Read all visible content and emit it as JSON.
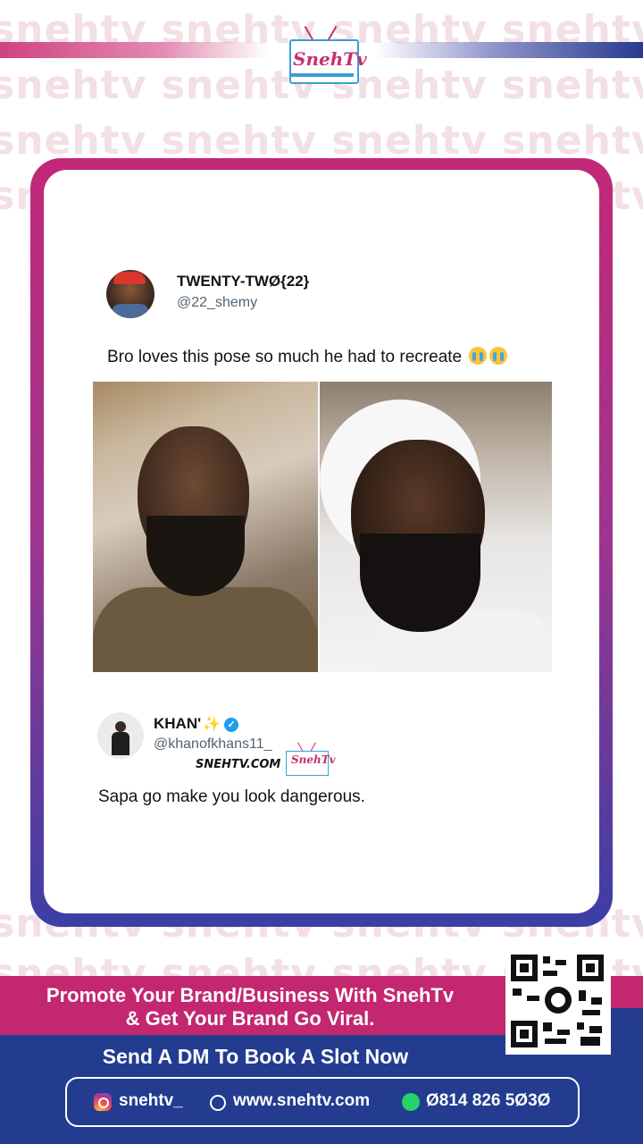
{
  "brand": {
    "watermark_text": "snehtv snehtv snehtv snehtv snehtv",
    "logo_text": "SnehTv",
    "colors": {
      "pink": "#c3276f",
      "blue": "#233c90",
      "twitter_blue": "#1d9bf0"
    }
  },
  "tweet1": {
    "display_name": "TWENTY-TWØ{22}",
    "handle": "@22_shemy",
    "text": "Bro loves this pose so much he had to recreate",
    "emoji": [
      "loudly-crying-face",
      "loudly-crying-face"
    ]
  },
  "tweet2": {
    "display_name": "KHAN'",
    "handle": "@khanofkhans11_",
    "verified": true,
    "watermark": "SNEHTV.COM",
    "text": "Sapa go make you look dangerous."
  },
  "promo": {
    "line1": "Promote Your Brand/Business With SnehTv",
    "line2": "& Get Your Brand Go Viral.",
    "cta": "Send A DM To Book A Slot Now",
    "instagram": "snehtv_",
    "website": "www.snehtv.com",
    "phone": "Ø814 826 5Ø3Ø"
  }
}
